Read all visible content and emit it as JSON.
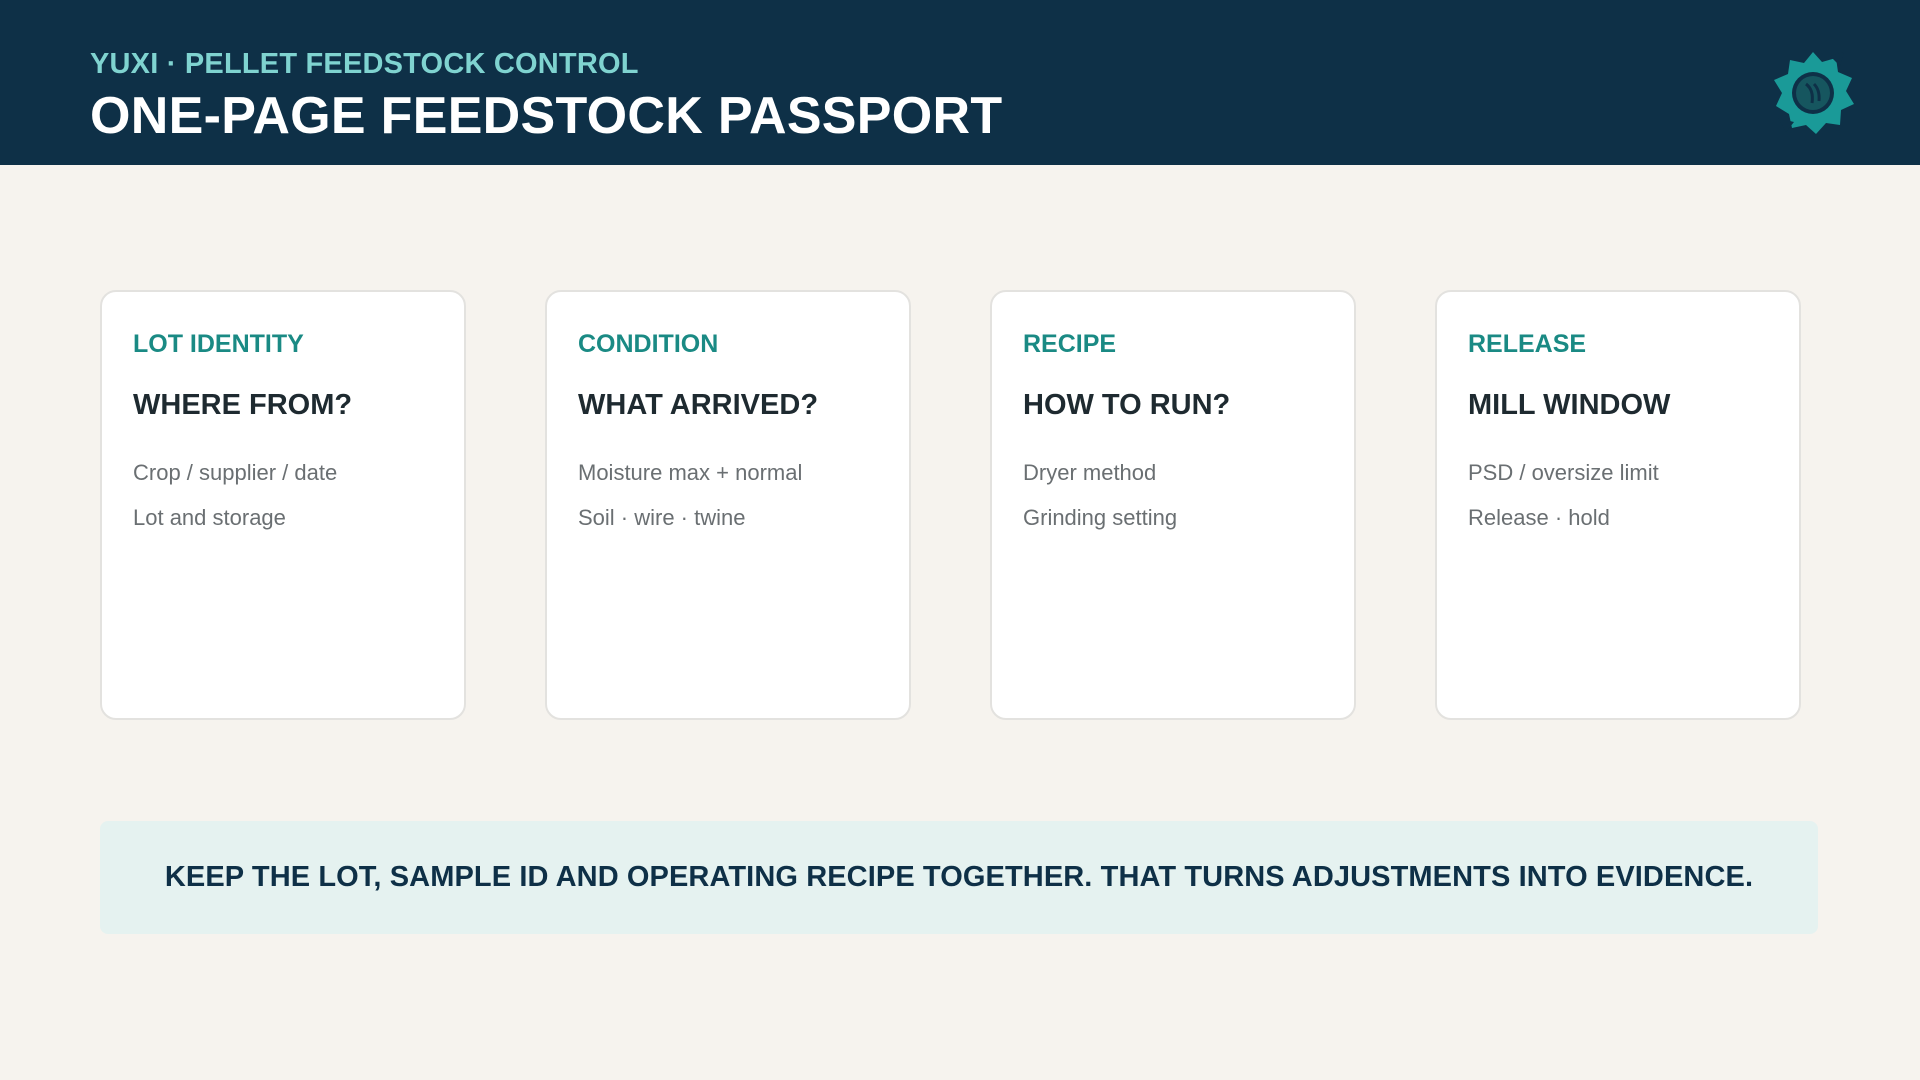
{
  "header": {
    "kicker": "YUXI · PELLET FEEDSTOCK CONTROL",
    "title": "ONE-PAGE FEEDSTOCK PASSPORT",
    "logo_icon": "gear-leaf-logo-icon"
  },
  "cards": [
    {
      "kicker": "LOT IDENTITY",
      "title": "WHERE FROM?",
      "lines": [
        "Crop / supplier / date",
        "Lot and storage"
      ]
    },
    {
      "kicker": "CONDITION",
      "title": "WHAT ARRIVED?",
      "lines": [
        "Moisture max + normal",
        "Soil · wire · twine"
      ]
    },
    {
      "kicker": "RECIPE",
      "title": "HOW TO RUN?",
      "lines": [
        "Dryer method",
        "Grinding setting"
      ]
    },
    {
      "kicker": "RELEASE",
      "title": "MILL WINDOW",
      "lines": [
        "PSD / oversize limit",
        "Release · hold"
      ]
    }
  ],
  "banner": {
    "text": "KEEP THE LOT, SAMPLE ID AND OPERATING RECIPE TOGETHER. THAT TURNS ADJUSTMENTS INTO EVIDENCE."
  },
  "colors": {
    "header_bg": "#0e3047",
    "accent_teal": "#1a8a84",
    "kicker_light": "#7fd3d0",
    "banner_bg": "#e5f2f0",
    "page_bg": "#f6f3ee"
  }
}
